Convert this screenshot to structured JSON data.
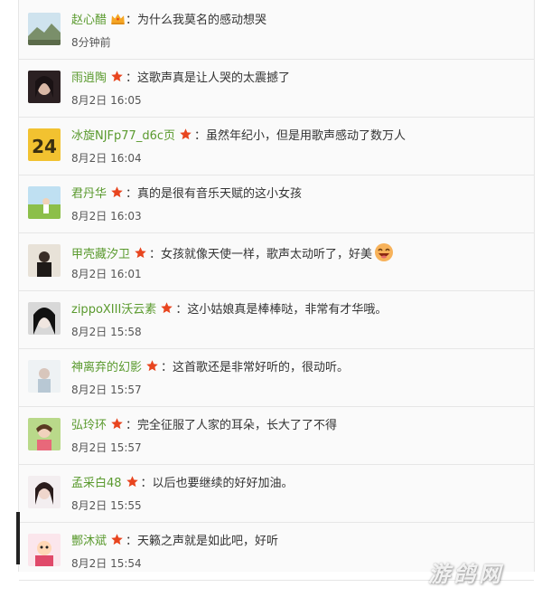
{
  "comments": [
    {
      "user": "赵心醋",
      "badge": "crown",
      "text": "：为什么我莫名的感动想哭",
      "time": "8分钟前",
      "avatar": "avatar-landscape-icon"
    },
    {
      "user": "雨逍陶",
      "badge": "star",
      "text": "：这歌声真是让人哭的太震撼了",
      "time": "8月2日 16:05",
      "avatar": "avatar-girl-icon"
    },
    {
      "user": "冰旋NJFp77_d6c页",
      "badge": "star",
      "text": "：虽然年纪小，但是用歌声感动了数万人",
      "time": "8月2日 16:04",
      "avatar": "avatar-number-24-icon",
      "avatar_text": "24"
    },
    {
      "user": "君丹华",
      "badge": "star",
      "text": "：真的是很有音乐天赋的这小女孩",
      "time": "8月2日 16:03",
      "avatar": "avatar-field-icon"
    },
    {
      "user": "甲壳藏汐卫",
      "badge": "star",
      "text": "：女孩就像天使一样，歌声太动听了，好美",
      "time": "8月2日 16:01",
      "avatar": "avatar-person-icon",
      "emoji": "laughing-emoji-icon"
    },
    {
      "user": "zippoXIII沃云素",
      "badge": "star",
      "text": "：这小姑娘真是棒棒哒，非常有才华哦。",
      "time": "8月2日 15:58",
      "avatar": "avatar-dark-portrait-icon"
    },
    {
      "user": "神离弃的幻影",
      "badge": "star",
      "text": "：这首歌还是非常好听的，很动听。",
      "time": "8月2日 15:57",
      "avatar": "avatar-light-portrait-icon"
    },
    {
      "user": "弘玲环",
      "badge": "star",
      "text": "：完全征服了人家的耳朵，长大了了不得",
      "time": "8月2日 15:57",
      "avatar": "avatar-colorful-icon"
    },
    {
      "user": "孟采白48",
      "badge": "star",
      "text": "：以后也要继续的好好加油。",
      "time": "8月2日 15:55",
      "avatar": "avatar-girl2-icon"
    },
    {
      "user": "酆沐斌",
      "badge": "star",
      "text": "：天籁之声就是如此吧，好听",
      "time": "8月2日 15:54",
      "avatar": "avatar-cartoon-icon"
    }
  ],
  "watermark": "游鸽网",
  "colors": {
    "username": "#5a9a2e",
    "star": "#e8451f",
    "crown": "#f5a623"
  }
}
